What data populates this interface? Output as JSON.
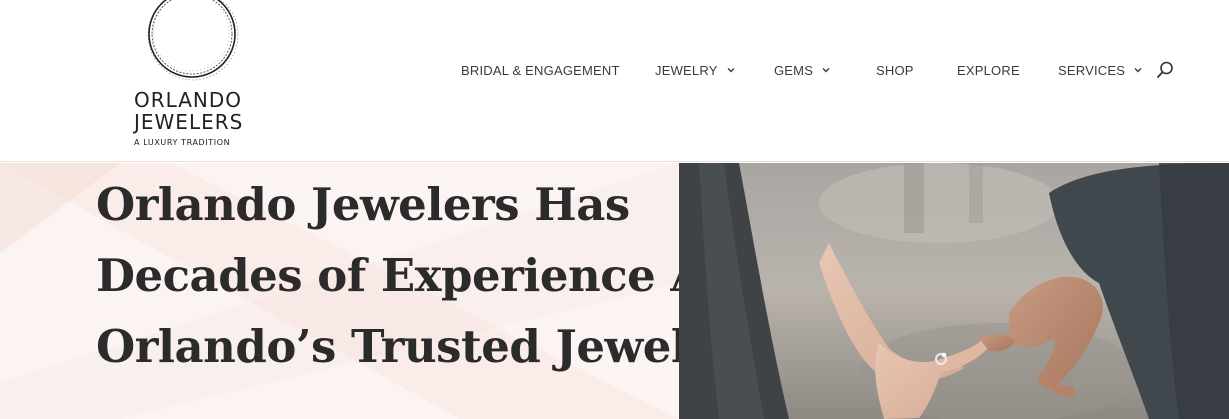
{
  "brand": {
    "name_line1": "ORLANDO",
    "name_line2": "JEWELERS",
    "tagline": "A LUXURY TRADITION"
  },
  "nav": {
    "items": [
      {
        "label": "BRIDAL & ENGAGEMENT",
        "has_dropdown": false
      },
      {
        "label": "JEWELRY",
        "has_dropdown": true
      },
      {
        "label": "GEMS",
        "has_dropdown": true
      },
      {
        "label": "SHOP",
        "has_dropdown": false
      },
      {
        "label": "EXPLORE",
        "has_dropdown": false
      },
      {
        "label": "SERVICES",
        "has_dropdown": true
      }
    ],
    "search_icon": "search-icon"
  },
  "hero": {
    "title_line1": "Orlando Jewelers Has",
    "title_line2": "Decades of Experience As",
    "title_line3": "Orlando’s Trusted Jeweler",
    "image": "couple-holding-pinkies-engagement-ring-photo"
  },
  "colors": {
    "hero_bg": "#fbf4f2",
    "text": "#2b2b2b",
    "nav_text": "#3a3a3a"
  }
}
